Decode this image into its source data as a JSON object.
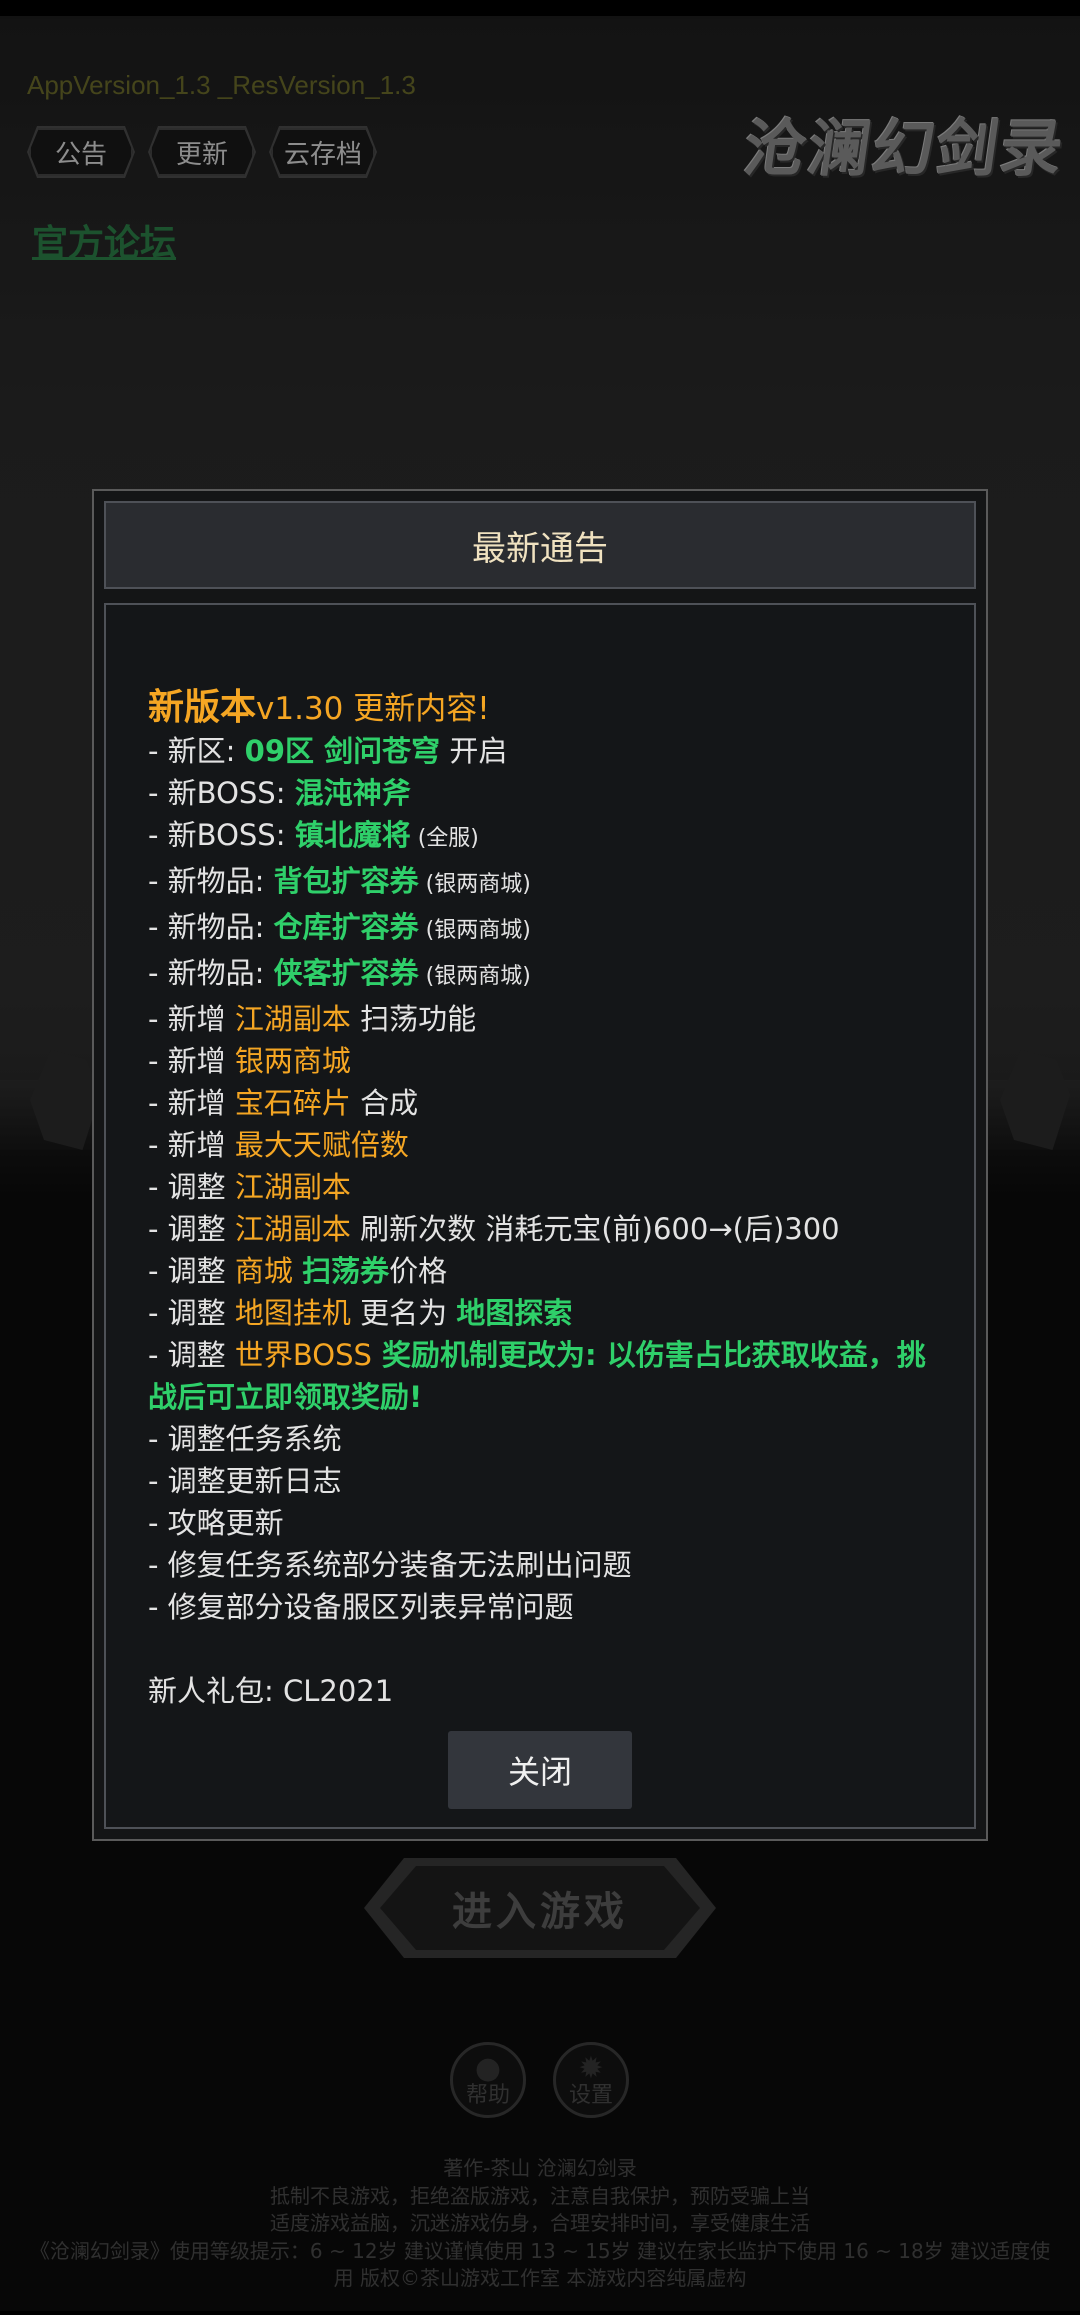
{
  "app": {
    "version_text": "AppVersion_1.3 _ResVersion_1.3",
    "logo_text": "沧澜幻剑录",
    "tabs": [
      {
        "label": "公告"
      },
      {
        "label": "更新"
      },
      {
        "label": "云存档"
      }
    ],
    "forum_link": "官方论坛",
    "enter_button": "进入游戏",
    "help_label": "帮助",
    "settings_label": "设置"
  },
  "footer": {
    "line1": "著作-茶山    沧澜幻剑录",
    "line2": "抵制不良游戏，拒绝盗版游戏，注意自我保护，预防受骗上当",
    "line3": "适度游戏益脑，沉迷游戏伤身，合理安排时间，享受健康生活",
    "line4": "《沧澜幻剑录》使用等级提示：6 ~ 12岁 建议谨慎使用   13 ~ 15岁 建议在家长监护下使用   16 ~ 18岁 建议适度使",
    "line5": "用   版权©茶山游戏工作室  本游戏内容纯属虚构"
  },
  "modal": {
    "title": "最新通告",
    "close_label": "关闭",
    "heading": {
      "main": "新版本",
      "version": "v1.30 更新内容!"
    },
    "lines": {
      "l1": {
        "a": "- 新区: ",
        "b": "09区 剑问苍穹",
        "c": " 开启"
      },
      "l2": {
        "a": "- 新BOSS: ",
        "b": "混沌神斧"
      },
      "l3": {
        "a": "- 新BOSS: ",
        "b": "镇北魔将",
        "c": " (全服)"
      },
      "l4": {
        "a": "- 新物品: ",
        "b": "背包扩容券",
        "c": " (银两商城)"
      },
      "l5": {
        "a": "- 新物品: ",
        "b": "仓库扩容券",
        "c": " (银两商城)"
      },
      "l6": {
        "a": "- 新物品: ",
        "b": "侠客扩容券",
        "c": " (银两商城)"
      },
      "l7": {
        "a": "- 新增 ",
        "b": "江湖副本",
        "c": " 扫荡功能"
      },
      "l8": {
        "a": "- 新增 ",
        "b": "银两商城"
      },
      "l9": {
        "a": "- 新增 ",
        "b": "宝石碎片",
        "c": " 合成"
      },
      "l10": {
        "a": "- 新增 ",
        "b": "最大天赋倍数"
      },
      "l11": {
        "a": "- 调整 ",
        "b": "江湖副本"
      },
      "l12": {
        "a": "- 调整 ",
        "b": "江湖副本",
        "c": " 刷新次数 消耗元宝(前)600→(后)300"
      },
      "l13": {
        "a": "- 调整 ",
        "b": "商城",
        "c": " ",
        "d": "扫荡券",
        "e": "价格"
      },
      "l14": {
        "a": "- 调整 ",
        "b": "地图挂机",
        "c": " 更名为 ",
        "d": "地图探索"
      },
      "l15": {
        "a": "- 调整 ",
        "b": "世界BOSS",
        "c": " 奖励机制更改为: 以伤害占比获取收益，挑战后可立即领取奖励!"
      },
      "l16": "- 调整任务系统",
      "l17": "- 调整更新日志",
      "l18": "- 攻略更新",
      "l19": "- 修复任务系统部分装备无法刷出问题",
      "l20": "- 修复部分设备服区列表异常问题",
      "l21": "新人礼包: CL2021"
    }
  }
}
